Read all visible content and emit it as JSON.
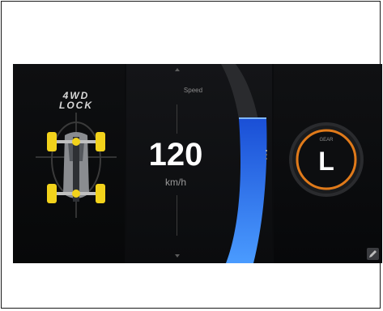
{
  "drive_mode": {
    "title_line1": "4WD",
    "title_line2": "LOCK"
  },
  "speed": {
    "label": "Speed",
    "value": "120",
    "unit": "km/h"
  },
  "gear": {
    "label": "GEAR",
    "value": "L"
  },
  "colors": {
    "accent_blue": "#3b8cff",
    "wheel_yellow": "#f2d21b",
    "gear_ring_orange": "#e07a1a"
  },
  "icons": [
    "4wd-lock-icon",
    "drivetrain-diagram",
    "scroll-up-icon",
    "scroll-down-icon",
    "edit-icon"
  ]
}
